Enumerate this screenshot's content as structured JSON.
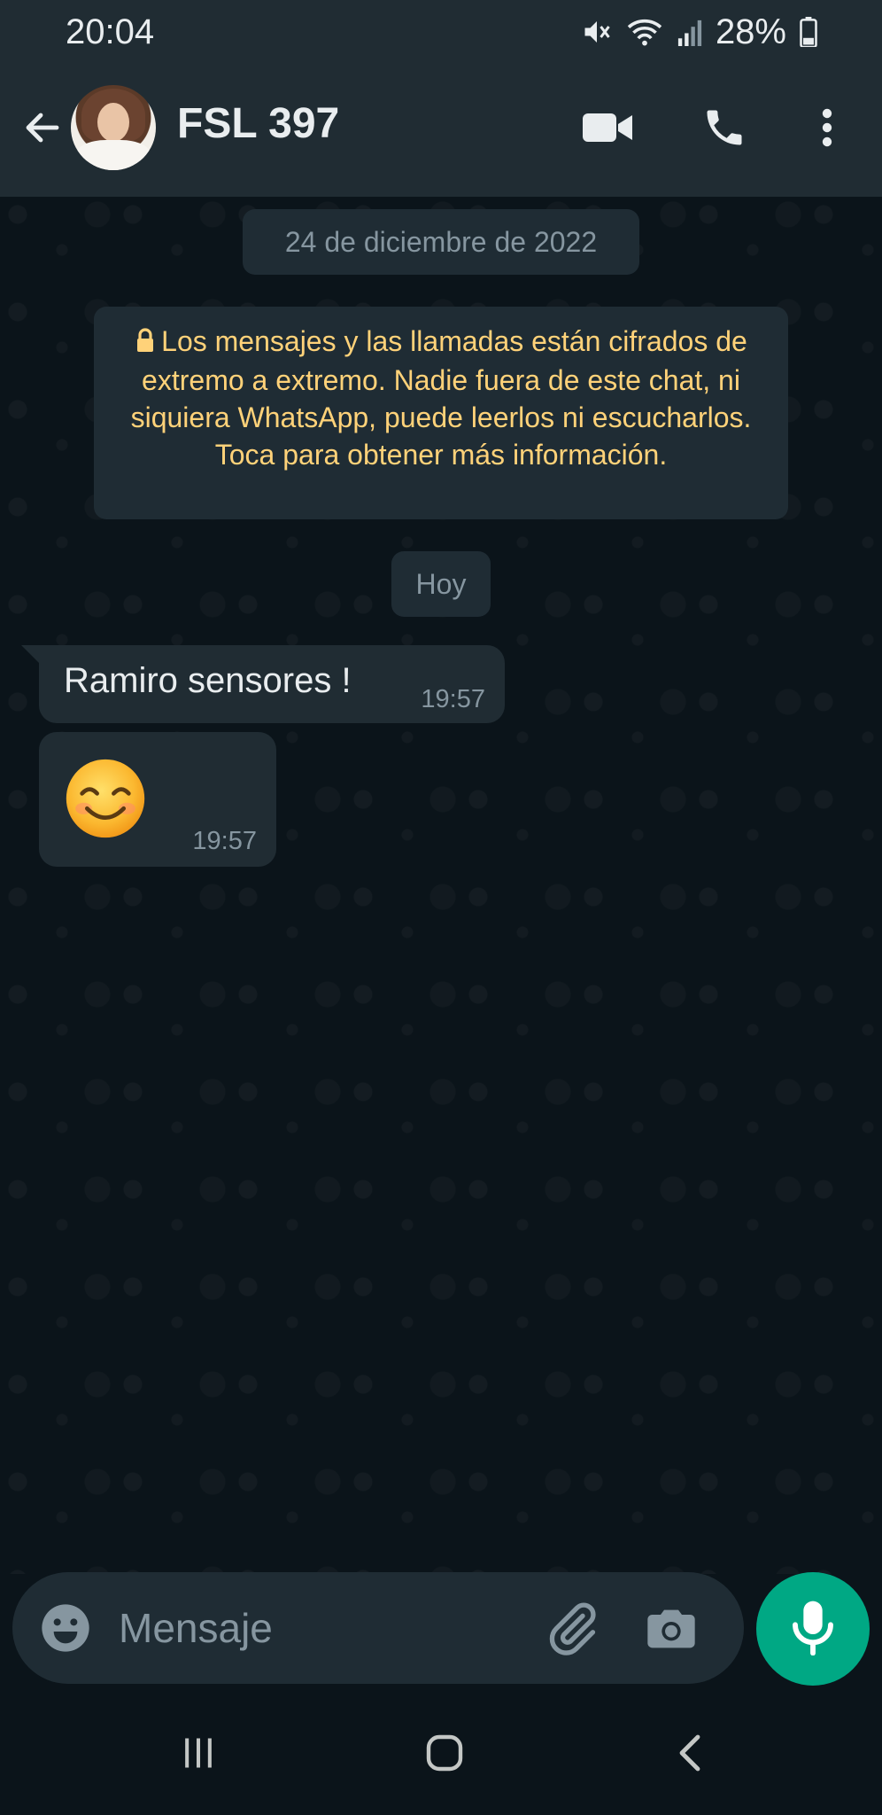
{
  "status_bar": {
    "time": "20:04",
    "battery": "28%",
    "icons": [
      "mute-icon",
      "wifi-icon",
      "signal-icon",
      "battery-icon"
    ]
  },
  "header": {
    "contact_name": "FSL 397",
    "icons": [
      "back-arrow-icon",
      "video-call-icon",
      "phone-icon",
      "more-vert-icon"
    ]
  },
  "chat": {
    "date_label": "24 de diciembre de 2022",
    "encryption_notice": "Los mensajes y las llamadas están cifrados de extremo a extremo. Nadie fuera de este chat, ni siquiera WhatsApp, puede leerlos ni escucharlos. Toca para obtener más información.",
    "today_label": "Hoy",
    "messages": [
      {
        "text": "Ramiro sensores !",
        "time": "19:57"
      },
      {
        "text": "",
        "emoji": "smiling-face-icon",
        "time": "19:57"
      }
    ]
  },
  "input_bar": {
    "placeholder": "Mensaje",
    "icons": [
      "emoji-icon",
      "attach-icon",
      "camera-icon",
      "mic-icon"
    ]
  },
  "colors": {
    "header_bg": "#202c33",
    "chat_bg": "#0b141a",
    "bubble_bg": "#202c33",
    "notice_text": "#ffd279",
    "accent": "#00a884",
    "muted_text": "#8696a0"
  }
}
